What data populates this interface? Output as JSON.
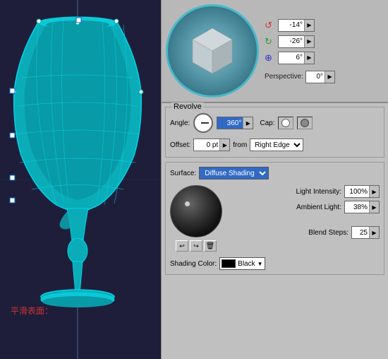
{
  "canvas": {
    "chinese_label": "平滑表面："
  },
  "view3d": {
    "angle_x": "-14°",
    "angle_y": "-26°",
    "angle_z": "6°",
    "perspective_label": "Perspective:",
    "perspective_value": "0°"
  },
  "revolve": {
    "section_label": "Revolve",
    "angle_label": "Angle:",
    "angle_value": "360°",
    "cap_label": "Cap:",
    "offset_label": "Offset:",
    "offset_value": "0 pt",
    "from_label": "from",
    "from_value": "Right Edge"
  },
  "surface": {
    "section_label": "Surface:",
    "surface_value": "Diffuse Shading",
    "light_intensity_label": "Light Intensity:",
    "light_intensity_value": "100%",
    "ambient_light_label": "Ambient Light:",
    "ambient_light_value": "38%",
    "blend_steps_label": "Blend Steps:",
    "blend_steps_value": "25",
    "shading_color_label": "Shading Color:",
    "shading_color_value": "Black"
  },
  "icons": {
    "arrow_right": "▶",
    "arrow_down": "▼",
    "rotate_x": "↺",
    "rotate_y": "↻",
    "undo": "↩",
    "trash": "🗑"
  }
}
